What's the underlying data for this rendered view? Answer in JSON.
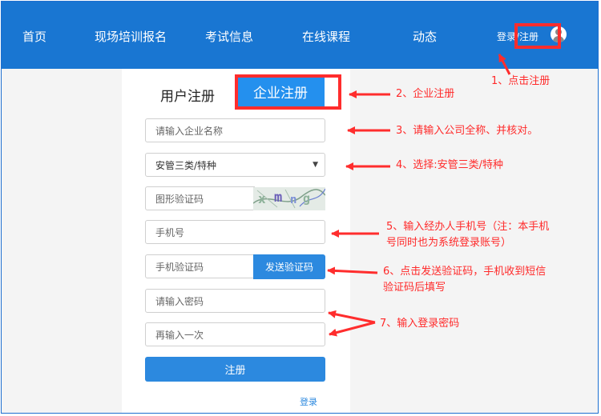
{
  "nav": {
    "items": [
      "首页",
      "现场培训报名",
      "考试信息",
      "在线课程",
      "动态"
    ],
    "login_register": "登录/注册",
    "bg_color": "#1976d2"
  },
  "tabs": {
    "user": "用户注册",
    "company": "企业注册"
  },
  "form": {
    "company_name_placeholder": "请输入企业名称",
    "category_selected": "安管三类/特种",
    "captcha_placeholder": "图形验证码",
    "phone_placeholder": "手机号",
    "sms_code_placeholder": "手机验证码",
    "send_code_label": "发送验证码",
    "password_placeholder": "请输入密码",
    "password_confirm_placeholder": "再输入一次",
    "submit_label": "注册",
    "login_link": "登录",
    "accent_color": "#2c89df"
  },
  "annotations": {
    "step1": "1、点击注册",
    "step2": "2、企业注册",
    "step3": "3、请输入公司全称、并核对。",
    "step4": "4、选择:安管三类/特种",
    "step5_line1": "5、输入经办人手机号（注：本手机",
    "step5_line2": "号同时也为系统登录账号）",
    "step6_line1": "6、点击发送验证码，手机收到短信",
    "step6_line2": "验证码后填写",
    "step7": "7、输入登录密码",
    "color": "#ff2d2d"
  }
}
